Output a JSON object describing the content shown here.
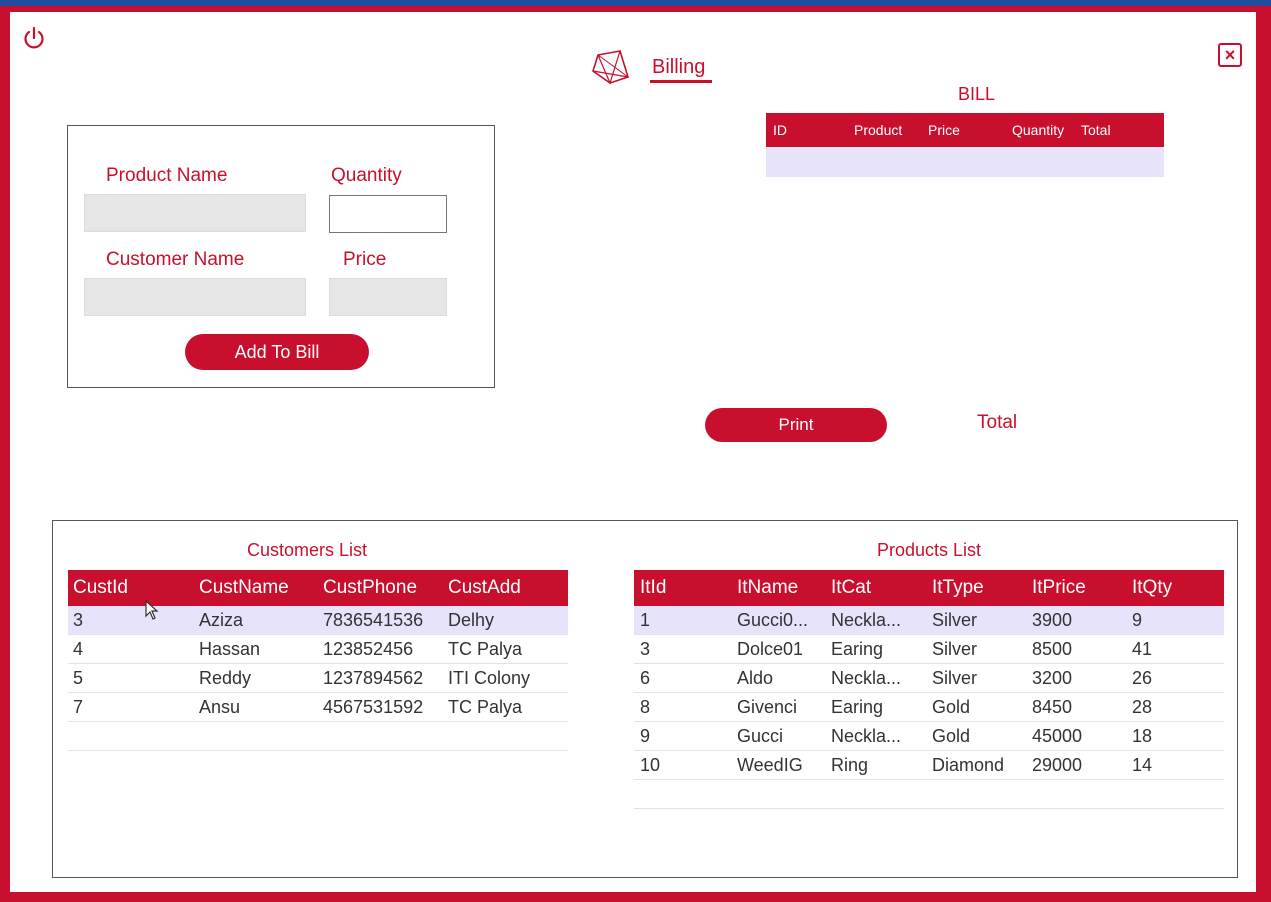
{
  "window": {
    "title": "Billing"
  },
  "colors": {
    "accent": "#c8102e",
    "selection": "#e6e3fb"
  },
  "icons": {
    "power": "power-icon",
    "logo": "gem-icon",
    "close": "close-icon"
  },
  "close_symbol": "×",
  "form": {
    "product_name_label": "Product Name",
    "quantity_label": "Quantity",
    "customer_name_label": "Customer Name",
    "price_label": "Price",
    "product_name_value": "",
    "quantity_value": "",
    "customer_name_value": "",
    "price_value": "",
    "add_button": "Add To Bill"
  },
  "bill": {
    "title": "BILL",
    "columns": [
      "ID",
      "Product",
      "Price",
      "Quantity",
      "Total"
    ]
  },
  "print_button": "Print",
  "total_label": "Total",
  "customers": {
    "title": "Customers List",
    "columns": [
      "CustId",
      "CustName",
      "CustPhone",
      "CustAdd"
    ],
    "rows": [
      [
        "3",
        "Aziza",
        "7836541536",
        "Delhy"
      ],
      [
        "4",
        "Hassan",
        "123852456",
        "TC Palya"
      ],
      [
        "5",
        "Reddy",
        "1237894562",
        "ITI Colony"
      ],
      [
        "7",
        "Ansu",
        "4567531592",
        "TC Palya"
      ]
    ]
  },
  "products": {
    "title": "Products List",
    "columns": [
      "ItId",
      "ItName",
      "ItCat",
      "ItType",
      "ItPrice",
      "ItQty"
    ],
    "rows": [
      [
        "1",
        "Gucci0...",
        "Neckla...",
        "Silver",
        "3900",
        "9"
      ],
      [
        "3",
        "Dolce01",
        "Earing",
        "Silver",
        "8500",
        "41"
      ],
      [
        "6",
        "Aldo",
        "Neckla...",
        "Silver",
        "3200",
        "26"
      ],
      [
        "8",
        "Givenci",
        "Earing",
        "Gold",
        "8450",
        "28"
      ],
      [
        "9",
        "Gucci",
        "Neckla...",
        "Gold",
        "45000",
        "18"
      ],
      [
        "10",
        "WeedIG",
        "Ring",
        "Diamond",
        "29000",
        "14"
      ]
    ]
  }
}
